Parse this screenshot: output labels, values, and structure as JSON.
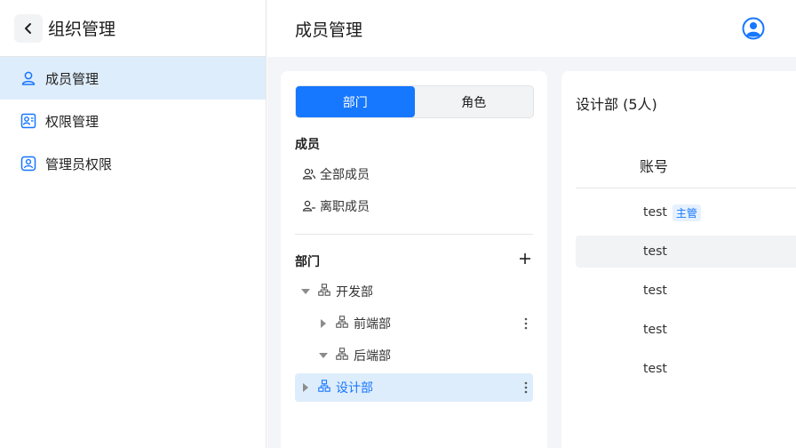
{
  "sidebar": {
    "title": "组织管理",
    "items": [
      {
        "label": "成员管理",
        "icon": "user-icon",
        "active": true
      },
      {
        "label": "权限管理",
        "icon": "user-permission-icon",
        "active": false
      },
      {
        "label": "管理员权限",
        "icon": "admin-badge-icon",
        "active": false
      }
    ]
  },
  "header": {
    "title": "成员管理"
  },
  "left_panel": {
    "tabs": [
      "部门",
      "角色"
    ],
    "members_section": "成员",
    "all_members": "全部成员",
    "left_members": "离职成员",
    "dept_section": "部门",
    "tree": [
      {
        "label": "开发部",
        "level": 0,
        "expanded": true,
        "selected": false
      },
      {
        "label": "前端部",
        "level": 1,
        "expanded": false,
        "selected": false
      },
      {
        "label": "后端部",
        "level": 1,
        "expanded": true,
        "selected": false
      },
      {
        "label": "设计部",
        "level": 0,
        "expanded": false,
        "selected": true
      }
    ]
  },
  "right_panel": {
    "dept_title": "设计部 (5人)",
    "column_account": "账号",
    "rows": [
      {
        "account": "test",
        "tag": "主管"
      },
      {
        "account": "test",
        "tag": ""
      },
      {
        "account": "test",
        "tag": ""
      },
      {
        "account": "test",
        "tag": ""
      },
      {
        "account": "test",
        "tag": ""
      }
    ]
  },
  "colors": {
    "accent": "#1677ff",
    "selected_bg": "#deedfb"
  }
}
